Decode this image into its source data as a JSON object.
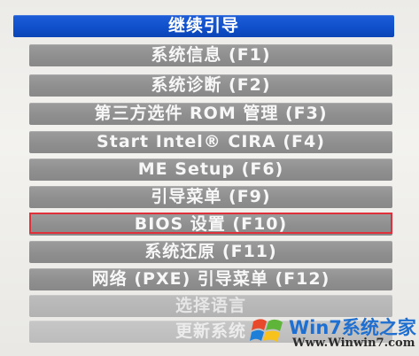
{
  "menu": {
    "items": [
      {
        "label": "继续引导",
        "state": "selected"
      },
      {
        "label": "系统信息 (F1)",
        "state": "normal"
      },
      {
        "label": "系统诊断 (F2)",
        "state": "normal"
      },
      {
        "label": "第三方选件 ROM 管理 (F3)",
        "state": "normal"
      },
      {
        "label": "Start Intel® CIRA (F4)",
        "state": "normal"
      },
      {
        "label": "ME Setup (F6)",
        "state": "normal"
      },
      {
        "label": "引导菜单 (F9)",
        "state": "normal"
      },
      {
        "label": "BIOS 设置 (F10)",
        "state": "highlighted"
      },
      {
        "label": "系统还原 (F11)",
        "state": "normal"
      },
      {
        "label": "网络 (PXE) 引导菜单 (F12)",
        "state": "normal"
      },
      {
        "label": "选择语言",
        "state": "faded"
      },
      {
        "label": "更新系统",
        "state": "faded"
      }
    ]
  },
  "watermark": {
    "title": "Win7系统之家",
    "url": "Www.Winwin7.com"
  },
  "colors": {
    "selected": "#0f4fc9",
    "normal": "#8f8f8f",
    "highlight_border": "#e0303a",
    "watermark_blue": "#1f6fd1"
  }
}
